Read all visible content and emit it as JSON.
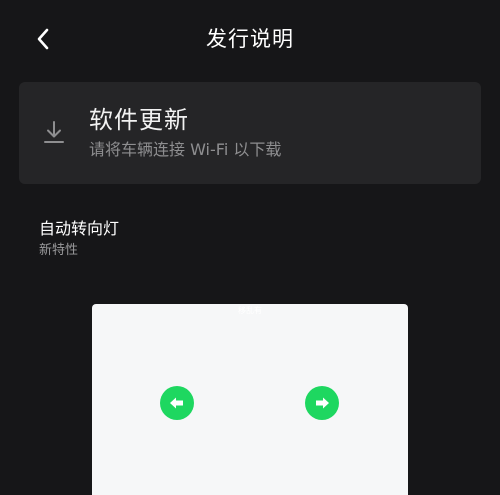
{
  "header": {
    "title": "发行说明",
    "back_icon": "chevron-left-icon"
  },
  "update_card": {
    "icon": "download-icon",
    "title": "软件更新",
    "subtitle": "请将车辆连接 Wi-Fi 以下载"
  },
  "feature": {
    "title": "自动转向灯",
    "subtitle": "新特性",
    "preview": {
      "caption": "移乱有",
      "left_icon": "left-turn-signal-icon",
      "right_icon": "right-turn-signal-icon",
      "signal_color": "#1ed760"
    }
  },
  "colors": {
    "background": "#161618",
    "card": "#252527",
    "text_primary": "#ffffff",
    "text_secondary": "#8e8e90"
  }
}
